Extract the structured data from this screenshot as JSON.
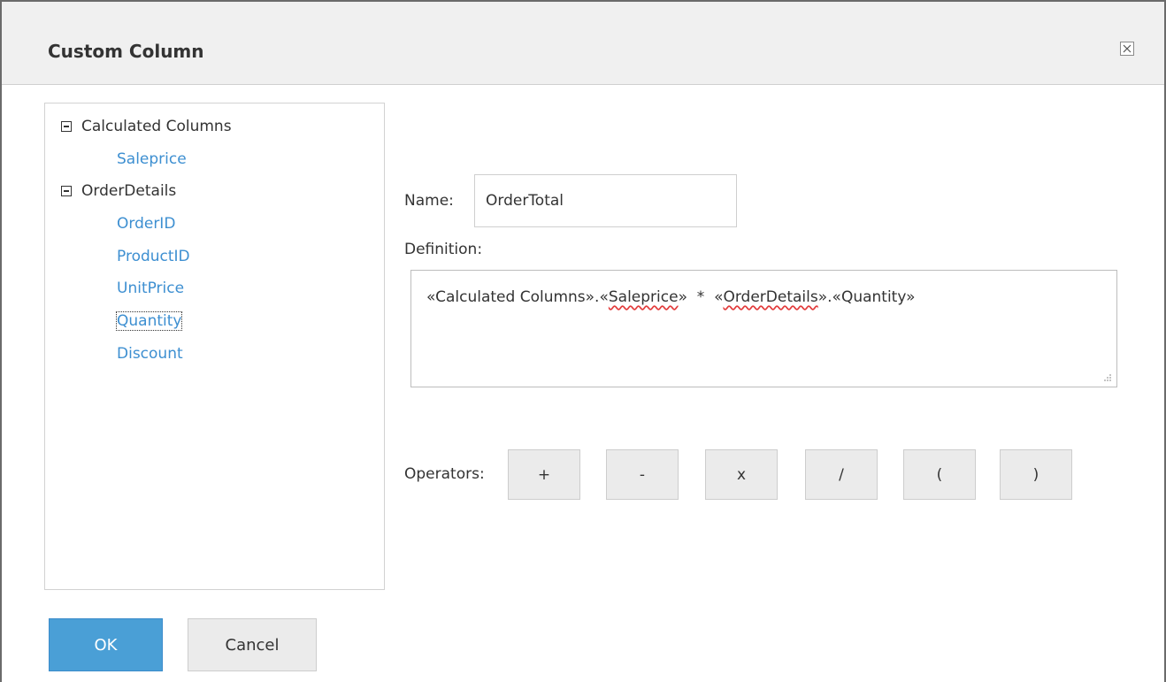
{
  "dialog": {
    "title": "Custom Column",
    "close_icon": "close-icon"
  },
  "tree": {
    "groups": [
      {
        "label": "Calculated Columns",
        "items": [
          "Saleprice"
        ]
      },
      {
        "label": "OrderDetails",
        "items": [
          "OrderID",
          "ProductID",
          "UnitPrice",
          "Quantity",
          "Discount"
        ]
      }
    ],
    "selected_item": "Quantity",
    "leaf_color": "#3d8fd1"
  },
  "form": {
    "name_label": "Name:",
    "name_value": "OrderTotal",
    "definition_label": "Definition:",
    "definition_parts": {
      "p1": "«Calculated Columns».«",
      "p2": "Saleprice",
      "p3": "»  *  «",
      "p4": "OrderDetails",
      "p5": "».«Quantity»"
    },
    "operators_label": "Operators:",
    "operators": [
      "+",
      "-",
      "x",
      "/",
      "(",
      ")"
    ]
  },
  "footer": {
    "ok_label": "OK",
    "cancel_label": "Cancel",
    "ok_color": "#4a9fd6"
  }
}
